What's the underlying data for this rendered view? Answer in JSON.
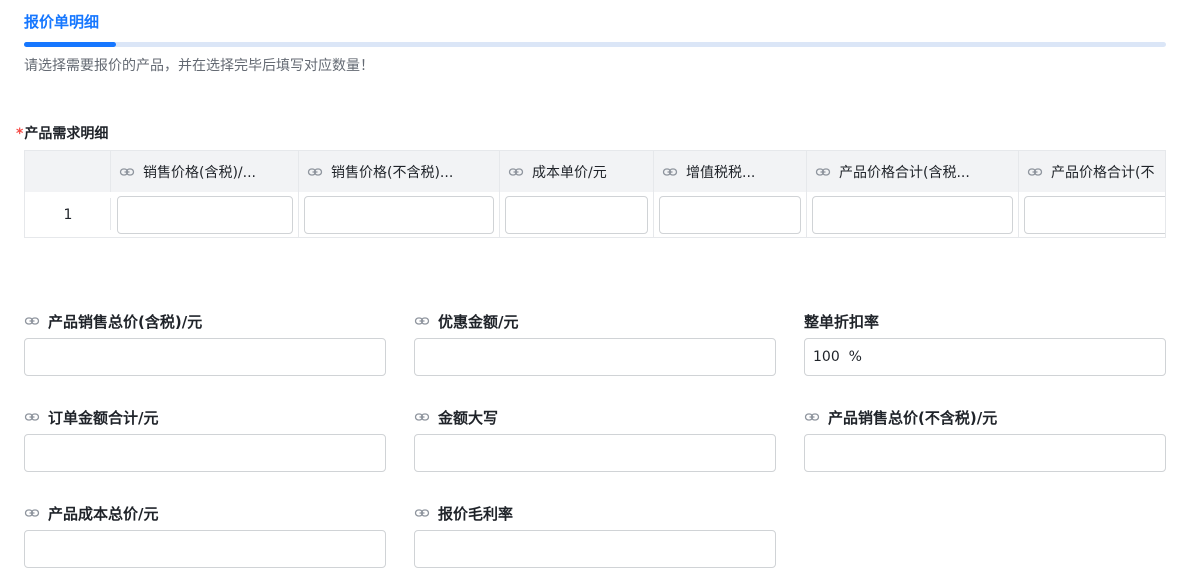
{
  "section": {
    "title": "报价单明细",
    "description": "请选择需要报价的产品，并在选择完毕后填写对应数量！"
  },
  "subtable": {
    "required_mark": "*",
    "label": "产品需求明细",
    "columns": [
      "销售价格(含税)/...",
      "销售价格(不含税)...",
      "成本单价/元",
      "增值税税...",
      "产品价格合计(含税...",
      "产品价格合计(不"
    ],
    "rows": [
      {
        "index": "1",
        "values": [
          "",
          "",
          "",
          "",
          "",
          ""
        ]
      }
    ]
  },
  "fields": {
    "total_sales_incl_tax": {
      "label": "产品销售总价(含税)/元",
      "value": ""
    },
    "discount_amount": {
      "label": "优惠金额/元",
      "value": ""
    },
    "order_discount_rate": {
      "label": "整单折扣率",
      "value": "100  %"
    },
    "order_total": {
      "label": "订单金额合计/元",
      "value": ""
    },
    "amount_in_words": {
      "label": "金额大写",
      "value": ""
    },
    "total_sales_excl_tax": {
      "label": "产品销售总价(不含税)/元",
      "value": ""
    },
    "total_cost": {
      "label": "产品成本总价/元",
      "value": ""
    },
    "gross_margin": {
      "label": "报价毛利率",
      "value": ""
    }
  },
  "icons": {
    "link": "link-icon"
  },
  "colors": {
    "accent": "#1677ff",
    "required": "#f54a45",
    "header_bg": "#f2f3f5"
  }
}
